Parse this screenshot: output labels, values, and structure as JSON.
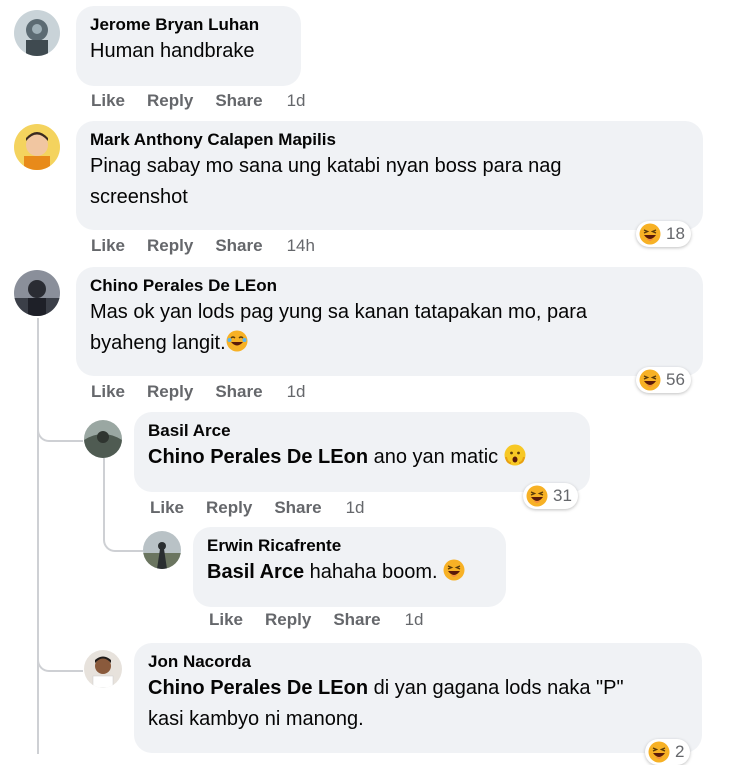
{
  "comments": [
    {
      "author": "Jerome Bryan Luhan",
      "text": "Human handbrake",
      "actions": {
        "like": "Like",
        "reply": "Reply",
        "share": "Share",
        "time": "1d"
      }
    },
    {
      "author": "Mark Anthony Calapen Mapilis",
      "text_line1": "Pinag sabay mo sana ung katabi nyan boss para nag",
      "text_line2": "screenshot",
      "actions": {
        "like": "Like",
        "reply": "Reply",
        "share": "Share",
        "time": "14h"
      },
      "reactions": "18"
    },
    {
      "author": "Chino Perales De LEon",
      "text_line1": "Mas ok yan lods pag yung sa kanan tatapakan mo, para",
      "text_line2": "byaheng langit.",
      "actions": {
        "like": "Like",
        "reply": "Reply",
        "share": "Share",
        "time": "1d"
      },
      "reactions": "56"
    },
    {
      "author": "Basil Arce",
      "mention": "Chino Perales De LEon",
      "text": "ano yan matic",
      "actions": {
        "like": "Like",
        "reply": "Reply",
        "share": "Share",
        "time": "1d"
      },
      "reactions": "31"
    },
    {
      "author": "Erwin Ricafrente",
      "mention": "Basil Arce",
      "text": "hahaha boom.",
      "actions": {
        "like": "Like",
        "reply": "Reply",
        "share": "Share",
        "time": "1d"
      }
    },
    {
      "author": "Jon Nacorda",
      "mention": "Chino Perales De LEon",
      "text_line1": "di yan gagana lods naka \"P\"",
      "text_line2": "kasi kambyo ni manong.",
      "reactions": "2"
    }
  ],
  "colors": {
    "bubble": "#f0f2f5",
    "meta": "#65676b",
    "text": "#050505",
    "haha": "#f7b125"
  },
  "icons": {
    "reaction": "haha-emoji-icon",
    "inline_haha": "laughing-emoji-icon",
    "inline_shock": "astonished-emoji-icon"
  }
}
